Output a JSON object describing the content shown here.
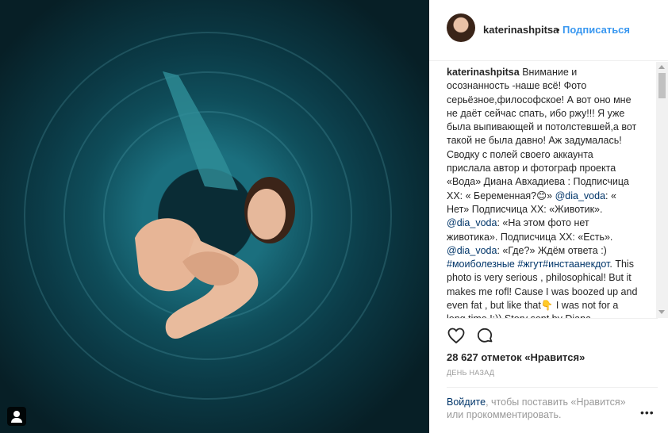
{
  "post": {
    "image_alt": "",
    "tagged_icon": "user-tag-icon"
  },
  "header": {
    "username": "katerinashpitsa",
    "separator": "•",
    "follow_label": "Подписаться"
  },
  "caption": {
    "username": "katerinashpitsa",
    "part1": " Внимание и осознанность -наше всё! Фото серьёзное,философское! А вот оно мне не даёт сейчас спать, ибо ржу!!! Я уже была выпивающей и потолстевшей,а вот такой не была давно! Аж задумалась! Сводку с полей своего аккаунта прислала автор и фотограф проекта «Вода» Диана Авхадиева : Подписчица ХХ: « Беременная?😊» ",
    "mention1": "@dia_voda",
    "part2": ": « Нет» Подписчица ХХ: «Животик». ",
    "mention2": "@dia_voda",
    "part3": ": «На этом фото нет животика». Подписчица ХХ: «Есть». ",
    "mention3": "@dia_voda",
    "part4": ": «Где?» Ждём ответа :) ",
    "hashtags": "#моиболезные #жгут#инстаанекдот",
    "part5": ". This photo is very serious , philosophical! But it makes me rofl! Cause I was boozed up and even fat , but like that👇 I was not for a long time !:)) Story sent by Diana Avkhadieva, author and photographer of"
  },
  "actions": {
    "like_icon": "heart-icon",
    "comment_icon": "comment-icon"
  },
  "likes_text": "28 627 отметок «Нравится»",
  "time_text": "ДЕНЬ НАЗАД",
  "login": {
    "link": "Войдите",
    "text": ", чтобы поставить «Нравится» или прокомментировать."
  },
  "more": "•••",
  "colors": {
    "link_blue": "#3897f0",
    "dark_link": "#003569",
    "water_teal": "#1b6f7e"
  }
}
